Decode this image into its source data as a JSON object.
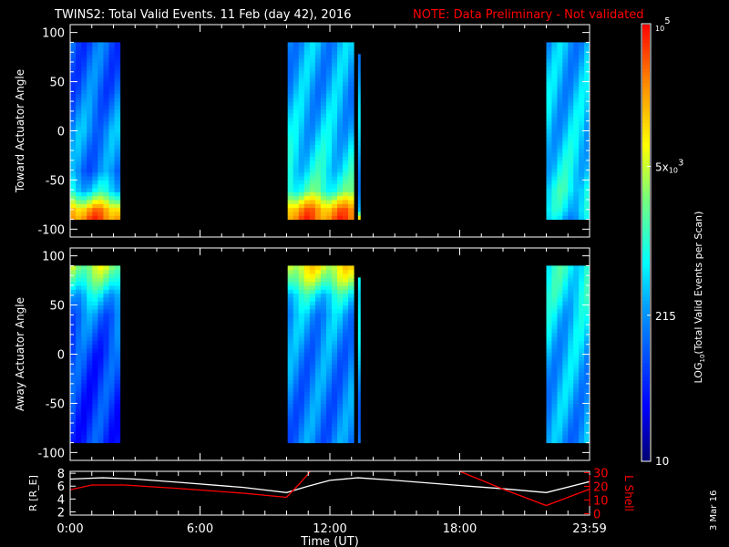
{
  "title": "TWINS2: Total Valid Events. 11 Feb (day  42), 2016",
  "note": "NOTE: Data Preliminary - Not validated",
  "date_stamp": "3 Mar 16",
  "colors": {
    "background": "#000000",
    "axes": "#ffffff",
    "note": "#ff0000",
    "lshell": "#ff0000",
    "radius": "#ffffff"
  },
  "chart_data": [
    {
      "type": "heatmap",
      "name": "toward",
      "ylabel": "Toward Actuator Angle",
      "ylim": [
        -108,
        108
      ],
      "yticks": [
        100,
        50,
        0,
        -50,
        -100
      ],
      "xlim": [
        0,
        24
      ],
      "blocks": [
        {
          "start": 0.0,
          "end": 2.3,
          "angles": [
            -90,
            -80,
            -70,
            -60,
            -40,
            0,
            40,
            90
          ],
          "values": [
            40000,
            20000,
            3000,
            500,
            150,
            200,
            120,
            100
          ]
        },
        {
          "start": 10.05,
          "end": 13.1,
          "angles": [
            -90,
            -80,
            -70,
            -60,
            -40,
            0,
            40,
            90
          ],
          "values": [
            40000,
            25000,
            6000,
            1200,
            600,
            350,
            250,
            250
          ]
        },
        {
          "start": 13.3,
          "end": 13.4,
          "angles": [
            -90,
            -80,
            -60,
            0,
            60,
            78
          ],
          "values": [
            30000,
            600,
            300,
            250,
            250,
            250
          ]
        },
        {
          "start": 22.0,
          "end": 24.0,
          "angles": [
            -90,
            -80,
            -60,
            -40,
            0,
            40,
            90
          ],
          "values": [
            300,
            500,
            700,
            500,
            350,
            300,
            250
          ]
        }
      ]
    },
    {
      "type": "heatmap",
      "name": "away",
      "ylabel": "Away Actuator Angle",
      "ylim": [
        -108,
        108
      ],
      "yticks": [
        100,
        50,
        0,
        -50,
        -100
      ],
      "xlim": [
        0,
        24
      ],
      "blocks": [
        {
          "start": 0.0,
          "end": 2.3,
          "angles": [
            -90,
            -50,
            0,
            40,
            60,
            75,
            90
          ],
          "values": [
            60,
            60,
            70,
            150,
            400,
            1500,
            4000
          ]
        },
        {
          "start": 10.05,
          "end": 13.1,
          "angles": [
            -90,
            -50,
            0,
            40,
            60,
            75,
            90
          ],
          "values": [
            150,
            150,
            170,
            250,
            600,
            3000,
            8000
          ]
        },
        {
          "start": 13.3,
          "end": 13.4,
          "angles": [
            -90,
            -50,
            0,
            60,
            78
          ],
          "values": [
            200,
            200,
            250,
            600,
            1500
          ]
        },
        {
          "start": 22.0,
          "end": 24.0,
          "angles": [
            -90,
            -50,
            0,
            40,
            60,
            90
          ],
          "values": [
            200,
            250,
            300,
            400,
            600,
            800
          ]
        }
      ]
    },
    {
      "type": "line",
      "name": "ephemeris",
      "xlabel": "Time (UT)",
      "xticks": [
        "0:00",
        "6:00",
        "12:00",
        "18:00",
        "23:59"
      ],
      "xtick_values": [
        0,
        6,
        12,
        18,
        24
      ],
      "ylabel": "R [R_E]",
      "ylabel_main": "R [R",
      "ylabel_sub": "E",
      "ylabel_end": "]",
      "ylim": [
        1.5,
        8.3
      ],
      "yticks": [
        "2",
        "4",
        "6",
        "8"
      ],
      "y2label": "L Shell",
      "y2lim": [
        -1,
        31
      ],
      "y2ticks": [
        "0",
        "10",
        "20",
        "30"
      ],
      "series": [
        {
          "name": "R",
          "color": "#ffffff",
          "x": [
            0,
            1.5,
            3,
            5,
            8,
            10,
            11,
            12,
            13.3,
            15,
            18,
            20,
            22,
            24
          ],
          "y": [
            7.1,
            7.3,
            7.1,
            6.6,
            5.8,
            5.0,
            6.0,
            6.9,
            7.3,
            6.9,
            6.1,
            5.6,
            5.0,
            6.7
          ]
        },
        {
          "name": "L Shell",
          "color": "#ff0000",
          "x": [
            0,
            1,
            2.5,
            5,
            8,
            10,
            10.6,
            11.1
          ],
          "y": [
            17.5,
            21,
            21,
            18.5,
            15,
            12,
            22,
            31
          ]
        },
        {
          "name": "L Shell (2)",
          "color": "#ff0000",
          "x": [
            18,
            20,
            22,
            24
          ],
          "y": [
            31,
            18,
            6,
            18
          ]
        }
      ]
    },
    {
      "type": "colorbar",
      "label_main": "LOG",
      "label_sub": "10",
      "label_rest": "(Total Valid Events per Scan)",
      "range": [
        10,
        100000
      ],
      "ticks": [
        {
          "value": 10,
          "label": "10"
        },
        {
          "value": 215,
          "label": "215"
        },
        {
          "value": 5000,
          "label": "5x",
          "sub": "10",
          "sup": "3"
        },
        {
          "value": 100000,
          "label": "",
          "sub": "10",
          "sup": "5"
        }
      ]
    }
  ]
}
